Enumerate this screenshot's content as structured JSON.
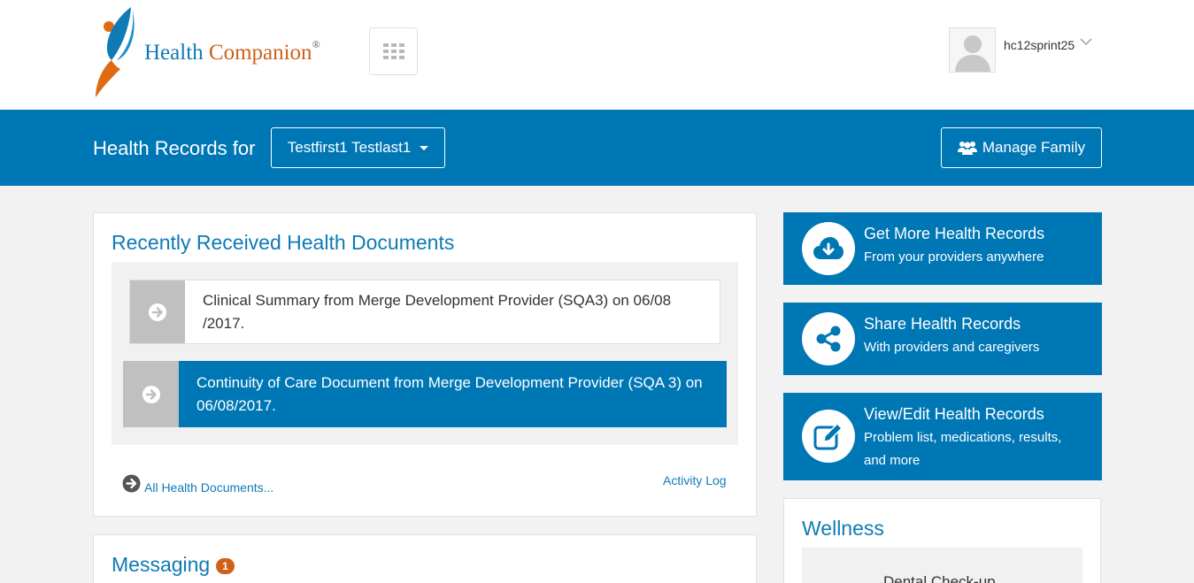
{
  "header": {
    "logo": {
      "word1": "Health",
      "word2": "Companion",
      "reg": "®"
    },
    "apps_icon": "grid-icon",
    "user": {
      "avatar_icon": "user-silhouette-icon",
      "name": "hc12sprint25",
      "chevron_icon": "chevron-down-icon"
    }
  },
  "band": {
    "title": "Health Records for",
    "patient": "Testfirst1 Testlast1",
    "manage_family": "Manage Family",
    "manage_family_icon": "users-icon"
  },
  "documents": {
    "title": "Recently Received Health Documents",
    "items": [
      {
        "text": "Clinical Summary from Merge Development Provider (SQA3) on 06/08 /2017.",
        "selected": false
      },
      {
        "text": "Continuity of Care Document from Merge Development Provider (SQA 3) on 06/08/2017.",
        "selected": true
      }
    ],
    "all_link": "All Health Documents...",
    "activity_log": "Activity Log"
  },
  "messaging": {
    "title": "Messaging",
    "count": "1"
  },
  "actions": [
    {
      "title": "Get More Health Records",
      "subtitle": "From your providers anywhere",
      "icon": "cloud-download-icon"
    },
    {
      "title": "Share Health Records",
      "subtitle": "With providers and caregivers",
      "icon": "share-icon"
    },
    {
      "title": "View/Edit Health Records",
      "subtitle": "Problem list, medications, results, and more",
      "icon": "edit-icon"
    }
  ],
  "wellness": {
    "title": "Wellness",
    "item": "Dental Check-up"
  },
  "colors": {
    "brand_blue": "#0077b5",
    "link_blue": "#0e7bb5",
    "brand_orange": "#d0611a",
    "page_bg": "#f2f2f2"
  }
}
